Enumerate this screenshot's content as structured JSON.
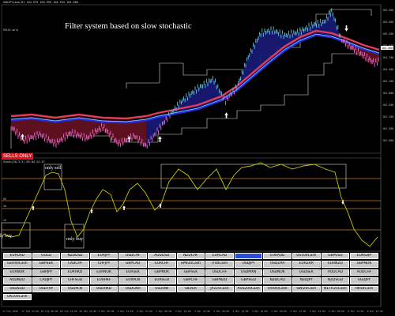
{
  "window": {
    "header": "USDJPYcash,H1  104.979 104.999 104.943 104.966",
    "sub_label": "SELLS only"
  },
  "title": "Filter system based on slow stochastic",
  "main_panel": {
    "status_badge": "SELLS ONLY",
    "price_scale": [
      "105.900",
      "105.600",
      "105.300",
      "105.000",
      "104.700",
      "104.400",
      "104.100",
      "103.800",
      "103.500",
      "103.200",
      "102.900",
      "102.600"
    ],
    "current_price": "104.966"
  },
  "oscillator": {
    "header": "Stoch(20,3,3) 65.04  24.57",
    "annotations": [
      "only sell",
      "only buy",
      "ly buy"
    ],
    "levels": [
      "80",
      "50",
      "20"
    ]
  },
  "symbols": {
    "rows": [
      [
        "EURUSD",
        "GOLD",
        "NZDUSD",
        "EURJPY",
        "USDCHF",
        "AUDUSD",
        "NZDCHF",
        "EURCAD",
        "USDJPYcash",
        "EURAUD",
        "US100Cash",
        "GBPUSD",
        "EURGBP"
      ],
      [
        "GER40Cash",
        "GBPSEK",
        "CADCHF",
        "CHFJPY",
        "GBPCAD",
        "EURCHF",
        "SPN35Cash",
        "IT40Cash",
        "USDJPY",
        "USDZAR",
        "EURZAR",
        "EURNZD",
        "GBPNOK"
      ],
      [
        "EURNOK",
        "GBPJPY",
        "EURHKD",
        "EURNOK",
        "EURSEK",
        "GBPNOK",
        "GBPSEK",
        "USDCHF",
        "USDMXN",
        "USDNOK",
        "USDSEK",
        "AUDCAD",
        "AUDCHF"
      ],
      [
        "AUDNZD",
        "CADJPY",
        "CHFSGD",
        "EURHKF",
        "EURPLN",
        "EURSGD",
        "GBPCHF",
        "GBPNZD",
        "GBPSGD",
        "NZDCAD",
        "NZDJPY",
        "NZDSGD",
        "SGDJPY"
      ],
      [
        "USDSGD",
        "USDTRY",
        "USDPLN",
        "USDHKD",
        "USDCNH",
        "USDOW",
        "SILVER",
        "JP225Cash",
        "AUS200Cash",
        "FRA40Cash",
        "SWI20Cash",
        "NETH25Cash",
        "HK50Cash"
      ],
      [
        "UK100Cash"
      ]
    ],
    "selected": "USDJPYcash"
  },
  "time_axis": [
    "27 Feb 2020",
    "27 Feb 22:00",
    "28 Feb 06:00",
    "28 Feb 14:00",
    "28 Feb 22:00",
    "2 Mar 06:00",
    "2 Mar 14:00",
    "2 Mar 22:00",
    "3 Mar 06:00",
    "3 Mar 14:00",
    "3 Mar 22:00",
    "4 Mar 06:00",
    "4 Mar 14:00",
    "4 Mar 22:00",
    "5 Mar 06:00",
    "5 Mar 14:00",
    "5 Mar 22:00",
    "6 Mar 06:00",
    "6 Mar 14:00",
    "6 Mar 22:00"
  ],
  "colors": {
    "background": "#000000",
    "band_upper": "#e23c5a",
    "band_lower": "#2030e0",
    "cloud": "#1a1a7a",
    "oscillator_line": "#c8c800",
    "level_line": "#cc7a1a",
    "selected_button": "#2a4dd8"
  }
}
